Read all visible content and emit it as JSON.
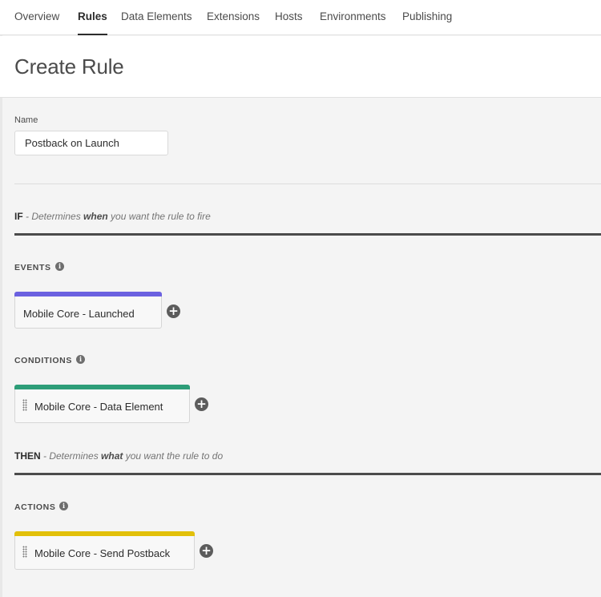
{
  "nav": {
    "tabs": [
      {
        "label": "Overview"
      },
      {
        "label": "Rules"
      },
      {
        "label": "Data Elements"
      },
      {
        "label": "Extensions"
      },
      {
        "label": "Hosts"
      },
      {
        "label": "Environments"
      },
      {
        "label": "Publishing"
      }
    ],
    "active_tab": "Rules"
  },
  "page": {
    "title": "Create Rule"
  },
  "form": {
    "name_label": "Name",
    "name_value": "Postback on Launch"
  },
  "if_section": {
    "keyword": "IF",
    "desc_prefix": " - Determines ",
    "desc_emphasis": "when",
    "desc_suffix": " you want the rule to fire"
  },
  "events": {
    "label": "EVENTS",
    "items": [
      {
        "label": "Mobile Core - Launched",
        "color": "#6b61e0"
      }
    ]
  },
  "conditions": {
    "label": "CONDITIONS",
    "items": [
      {
        "label": "Mobile Core - Data Element",
        "color": "#2d9d78"
      }
    ]
  },
  "then_section": {
    "keyword": "THEN",
    "desc_prefix": " - Determines ",
    "desc_emphasis": "what",
    "desc_suffix": " you want the rule to do"
  },
  "actions": {
    "label": "ACTIONS",
    "items": [
      {
        "label": "Mobile Core - Send Postback",
        "color": "#e2c00a"
      }
    ]
  },
  "icons": {
    "info": "info-icon",
    "add": "plus-circle-icon",
    "grip": "drag-handle-icon",
    "info_glyph": "i",
    "add_glyph": "+"
  }
}
